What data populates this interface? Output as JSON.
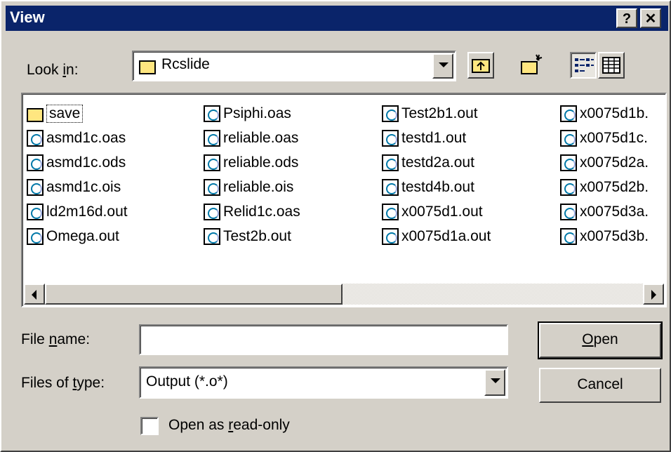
{
  "window": {
    "title": "View",
    "help_glyph": "?",
    "close_glyph": "✕"
  },
  "lookin": {
    "label_pre": "Look ",
    "label_mnemonic": "i",
    "label_post": "n:",
    "value": "Rcslide"
  },
  "toolbar": {
    "up_icon": "folder-up-icon",
    "new_folder_icon": "new-folder-icon",
    "list_view_icon": "list-view-icon",
    "details_view_icon": "details-view-icon"
  },
  "files": {
    "columns": [
      [
        {
          "name": "save",
          "type": "folder",
          "selected": true
        },
        {
          "name": "asmd1c.oas",
          "type": "doc"
        },
        {
          "name": "asmd1c.ods",
          "type": "doc"
        },
        {
          "name": "asmd1c.ois",
          "type": "doc"
        },
        {
          "name": "ld2m16d.out",
          "type": "doc"
        },
        {
          "name": "Omega.out",
          "type": "doc"
        }
      ],
      [
        {
          "name": "Psiphi.oas",
          "type": "doc"
        },
        {
          "name": "reliable.oas",
          "type": "doc"
        },
        {
          "name": "reliable.ods",
          "type": "doc"
        },
        {
          "name": "reliable.ois",
          "type": "doc"
        },
        {
          "name": "Relid1c.oas",
          "type": "doc"
        },
        {
          "name": "Test2b.out",
          "type": "doc"
        }
      ],
      [
        {
          "name": "Test2b1.out",
          "type": "doc"
        },
        {
          "name": "testd1.out",
          "type": "doc"
        },
        {
          "name": "testd2a.out",
          "type": "doc"
        },
        {
          "name": "testd4b.out",
          "type": "doc"
        },
        {
          "name": "x0075d1.out",
          "type": "doc"
        },
        {
          "name": "x0075d1a.out",
          "type": "doc"
        }
      ],
      [
        {
          "name": "x0075d1b.",
          "type": "doc"
        },
        {
          "name": "x0075d1c.",
          "type": "doc"
        },
        {
          "name": "x0075d2a.",
          "type": "doc"
        },
        {
          "name": "x0075d2b.",
          "type": "doc"
        },
        {
          "name": "x0075d3a.",
          "type": "doc"
        },
        {
          "name": "x0075d3b.",
          "type": "doc"
        }
      ]
    ]
  },
  "filename": {
    "label_pre": "File ",
    "label_mnemonic": "n",
    "label_post": "ame:",
    "value": ""
  },
  "filetype": {
    "label_pre": "Files of ",
    "label_mnemonic": "t",
    "label_post": "ype:",
    "value": "Output (*.o*)"
  },
  "readonly": {
    "label_pre": "Open as ",
    "label_mnemonic": "r",
    "label_post": "ead-only",
    "checked": false
  },
  "buttons": {
    "open_mnemonic": "O",
    "open_rest": "pen",
    "cancel": "Cancel"
  }
}
